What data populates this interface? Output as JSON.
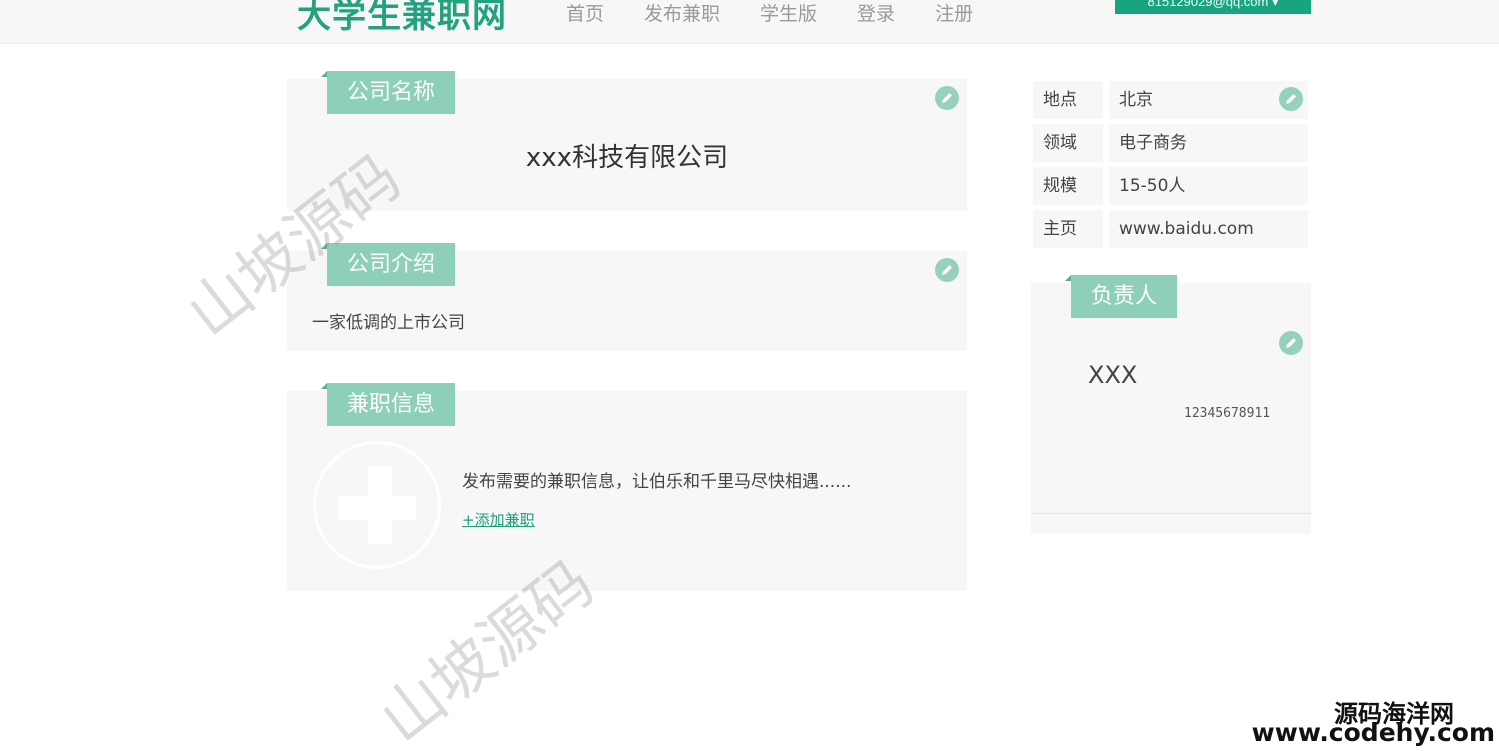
{
  "header": {
    "logo": "大学生兼职网",
    "nav": [
      "首页",
      "发布兼职",
      "学生版",
      "登录",
      "注册"
    ],
    "user_email": "815129029@qq.com ▾"
  },
  "company_name_panel": {
    "tag": "公司名称",
    "name": "xxx科技有限公司"
  },
  "intro_panel": {
    "tag": "公司介绍",
    "text": "一家低调的上市公司"
  },
  "parttime_panel": {
    "tag": "兼职信息",
    "description": "发布需要的兼职信息，让伯乐和千里马尽快相遇......",
    "add_link": "+添加兼职"
  },
  "info": [
    {
      "key": "地点",
      "value": "北京"
    },
    {
      "key": "领域",
      "value": "电子商务"
    },
    {
      "key": "规模",
      "value": "15-50人"
    },
    {
      "key": "主页",
      "value": "www.baidu.com"
    }
  ],
  "contact_panel": {
    "tag": "负责人",
    "name": "XXX",
    "phone": "12345678911"
  },
  "watermarks": {
    "diagonal": "山坡源码",
    "corner_line1": "源码海洋网",
    "corner_line2": "www.codehy.com"
  },
  "colors": {
    "brand": "#23a27f",
    "tag": "#8dcfb9",
    "panel_bg": "#f7f7f7",
    "link": "#1b9f7c"
  }
}
